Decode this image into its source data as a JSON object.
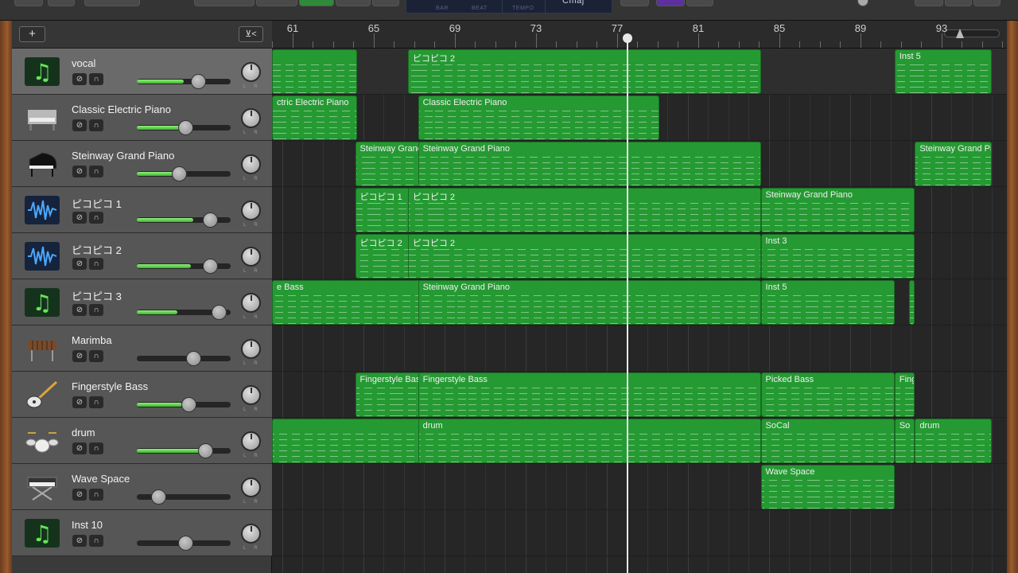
{
  "toolbar": {
    "lcd": {
      "bar": "BAR",
      "beat": "BEAT",
      "tempo": "TEMPO",
      "key": "Cmaj"
    }
  },
  "header": {
    "add_label": "+",
    "filter_label": "⊻<"
  },
  "tracks": [
    {
      "name": "vocal",
      "icon": "music-note-icon",
      "volume": 0.65,
      "fill": 0.5,
      "selected": true
    },
    {
      "name": "Classic Electric Piano",
      "icon": "electric-piano-icon",
      "volume": 0.52,
      "fill": 0.5
    },
    {
      "name": "Steinway Grand Piano",
      "icon": "grand-piano-icon",
      "volume": 0.45,
      "fill": 0.45
    },
    {
      "name": "ピコピコ 1",
      "icon": "waveform-icon",
      "volume": 0.78,
      "fill": 0.6
    },
    {
      "name": "ピコピコ 2",
      "icon": "waveform-icon",
      "volume": 0.78,
      "fill": 0.58
    },
    {
      "name": "ピコピコ 3",
      "icon": "music-note-icon",
      "volume": 0.87,
      "fill": 0.43
    },
    {
      "name": "Marimba",
      "icon": "marimba-icon",
      "volume": 0.6,
      "fill": 0.0
    },
    {
      "name": "Fingerstyle Bass",
      "icon": "bass-guitar-icon",
      "volume": 0.55,
      "fill": 0.48
    },
    {
      "name": "drum",
      "icon": "drum-kit-icon",
      "volume": 0.73,
      "fill": 0.8
    },
    {
      "name": "Wave Space",
      "icon": "synth-keyboard-icon",
      "volume": 0.23,
      "fill": 0.0
    },
    {
      "name": "Inst 10",
      "icon": "music-note-icon",
      "volume": 0.52,
      "fill": 0.0
    }
  ],
  "ruler": {
    "bars": [
      "61",
      "65",
      "69",
      "73",
      "77",
      "81",
      "85",
      "89",
      "93"
    ]
  },
  "regions": [
    [
      {
        "name": "",
        "start": 60.0,
        "end": 64.7
      },
      {
        "name": "ピコピコ 2",
        "start": 67.2,
        "end": 84.6
      },
      {
        "name": "Inst 5",
        "start": 91.2,
        "end": 96.0
      }
    ],
    [
      {
        "name": "ctric Electric Piano",
        "start": 60.0,
        "end": 64.7
      },
      {
        "name": "Classic Electric Piano",
        "start": 67.7,
        "end": 79.6
      }
    ],
    [
      {
        "name": "Steinway Grand",
        "start": 64.6,
        "end": 68.1
      },
      {
        "name": "Steinway Grand Piano",
        "start": 67.7,
        "end": 84.6
      },
      {
        "name": "Steinway Grand Piano",
        "start": 92.2,
        "end": 96.0
      }
    ],
    [
      {
        "name": "ピコピコ 1",
        "start": 64.6,
        "end": 68.1
      },
      {
        "name": "ピコピコ 2",
        "start": 67.2,
        "end": 84.6
      },
      {
        "name": "Steinway Grand Piano",
        "start": 84.6,
        "end": 92.2
      }
    ],
    [
      {
        "name": "ピコピコ 2",
        "start": 64.6,
        "end": 68.1
      },
      {
        "name": "ピコピコ 2",
        "start": 67.2,
        "end": 84.6
      },
      {
        "name": "Inst 3",
        "start": 84.6,
        "end": 92.2
      }
    ],
    [
      {
        "name": "e Bass",
        "start": 60.0,
        "end": 68.1
      },
      {
        "name": "Steinway Grand Piano",
        "start": 67.7,
        "end": 84.6
      },
      {
        "name": "Inst 5",
        "start": 84.6,
        "end": 91.2
      },
      {
        "name": "",
        "start": 91.9,
        "end": 92.2
      }
    ],
    [],
    [
      {
        "name": "Fingerstyle Bas",
        "start": 64.6,
        "end": 68.1
      },
      {
        "name": "Fingerstyle Bass",
        "start": 67.7,
        "end": 84.6
      },
      {
        "name": "Picked Bass",
        "start": 84.6,
        "end": 91.2
      },
      {
        "name": "Fing",
        "start": 91.2,
        "end": 92.2
      }
    ],
    [
      {
        "name": "",
        "start": 60.0,
        "end": 68.1
      },
      {
        "name": "drum",
        "start": 67.7,
        "end": 84.6
      },
      {
        "name": "SoCal",
        "start": 84.6,
        "end": 91.2
      },
      {
        "name": "So",
        "start": 91.2,
        "end": 92.2
      },
      {
        "name": "drum",
        "start": 92.2,
        "end": 96.0
      }
    ],
    [
      {
        "name": "Wave Space",
        "start": 84.6,
        "end": 91.2
      }
    ],
    []
  ],
  "playhead_bar": 78.0,
  "colors": {
    "region": "#259a33",
    "volume": "#5fd24b",
    "accent": "#5e2f9e"
  }
}
